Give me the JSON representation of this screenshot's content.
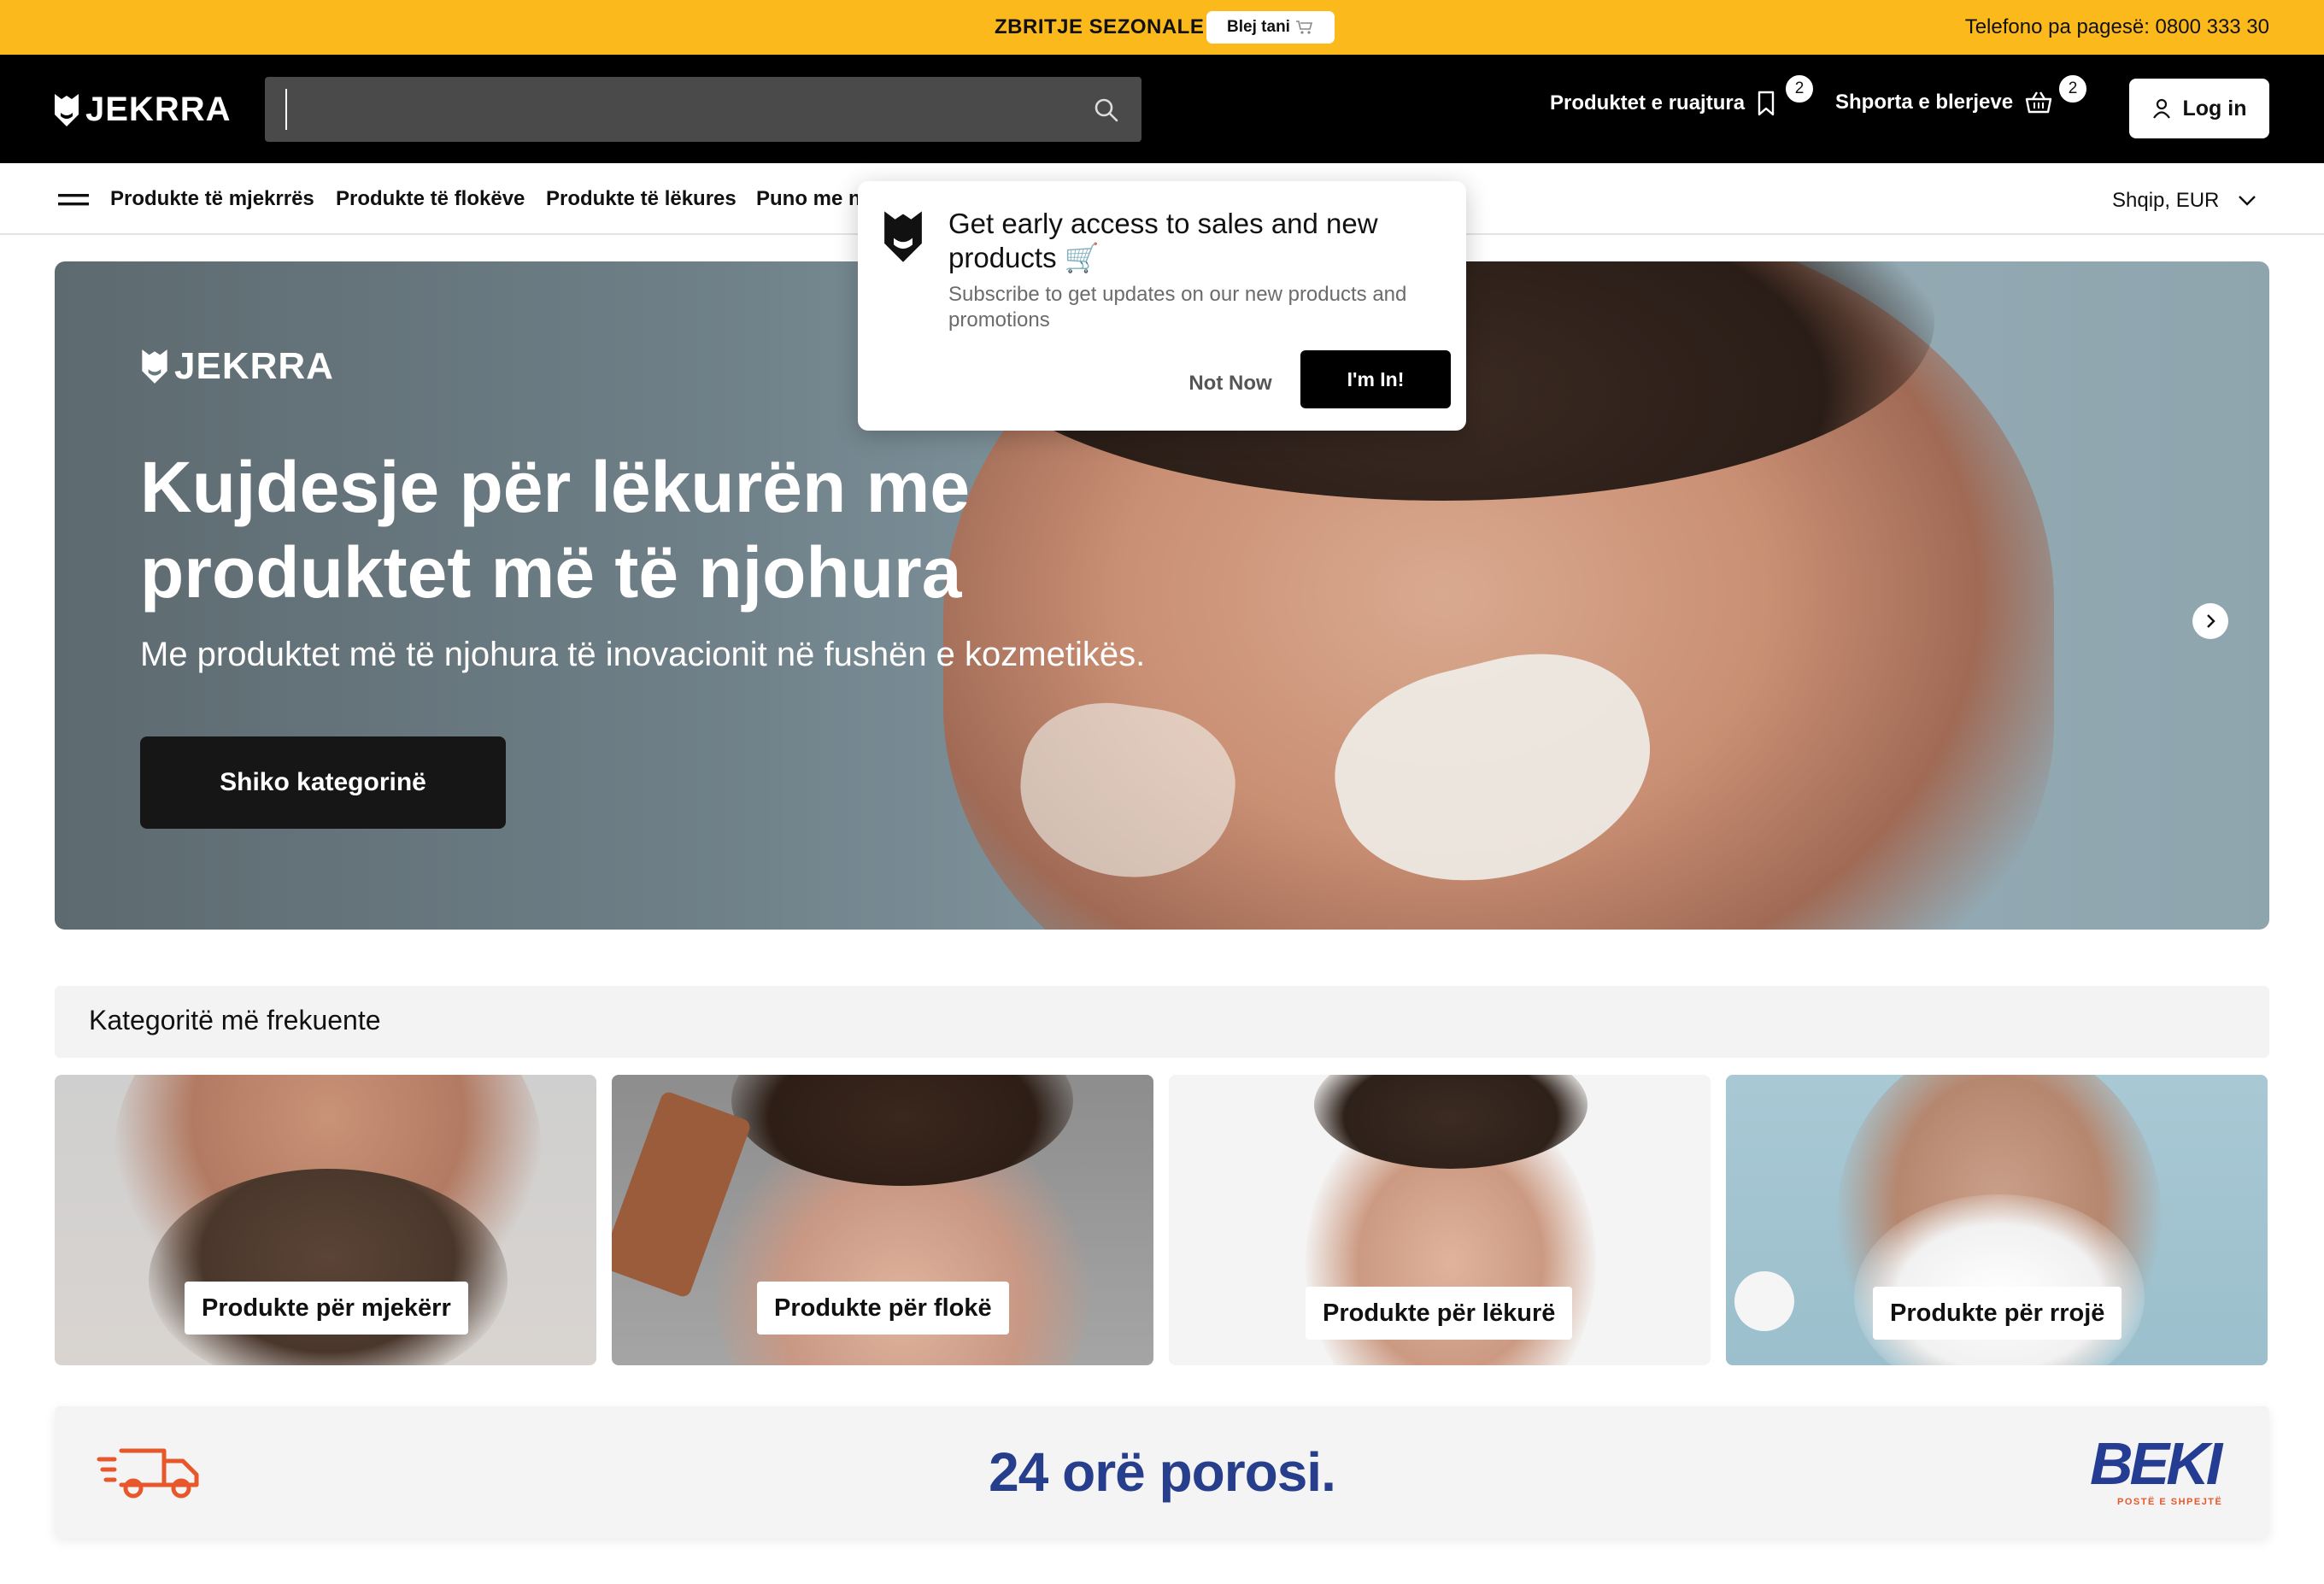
{
  "promo": {
    "label": "ZBRITJE SEZONALE",
    "button_label": "Blej tani",
    "phone": "Telefono pa pagesë: 0800 333 30"
  },
  "header": {
    "logo": "JEKRRA",
    "search_placeholder": "",
    "saved_label": "Produktet e ruajtura",
    "saved_count": "2",
    "cart_label": "Shporta e blerjeve",
    "cart_count": "2",
    "login_label": "Log in"
  },
  "nav": {
    "items": [
      "Produkte të mjekrrës",
      "Produkte të flokëve",
      "Produkte të lëkures",
      "Puno me n"
    ],
    "locale": "Shqip, EUR"
  },
  "hero": {
    "logo": "JEKRRA",
    "title": "Kujdesje për lëkurën me produktet më të njohura",
    "subtitle": "Me produktet më të njohura të inovacionit në fushën e kozmetikës.",
    "cta_label": "Shiko kategorinë"
  },
  "popup": {
    "title": "Get early access to sales and new products 🛒",
    "description": "Subscribe to get updates on our new products and promotions",
    "dismiss_label": "Not Now",
    "accept_label": "I'm In!"
  },
  "categories": {
    "title": "Kategoritë më frekuente",
    "cards": [
      {
        "label": "Produkte për mjekërr"
      },
      {
        "label": "Produkte për flokë"
      },
      {
        "label": "Produkte për lëkurë"
      },
      {
        "label": "Produkte për rrojë"
      }
    ]
  },
  "delivery": {
    "text": "24 orë porosi.",
    "partner_logo": "BEKI",
    "partner_tagline": "POSTË E SHPEJTË"
  },
  "colors": {
    "promo_bg": "#fbb91c",
    "header_bg": "#000000",
    "delivery_text": "#263e8c",
    "truck": "#e8572b"
  }
}
